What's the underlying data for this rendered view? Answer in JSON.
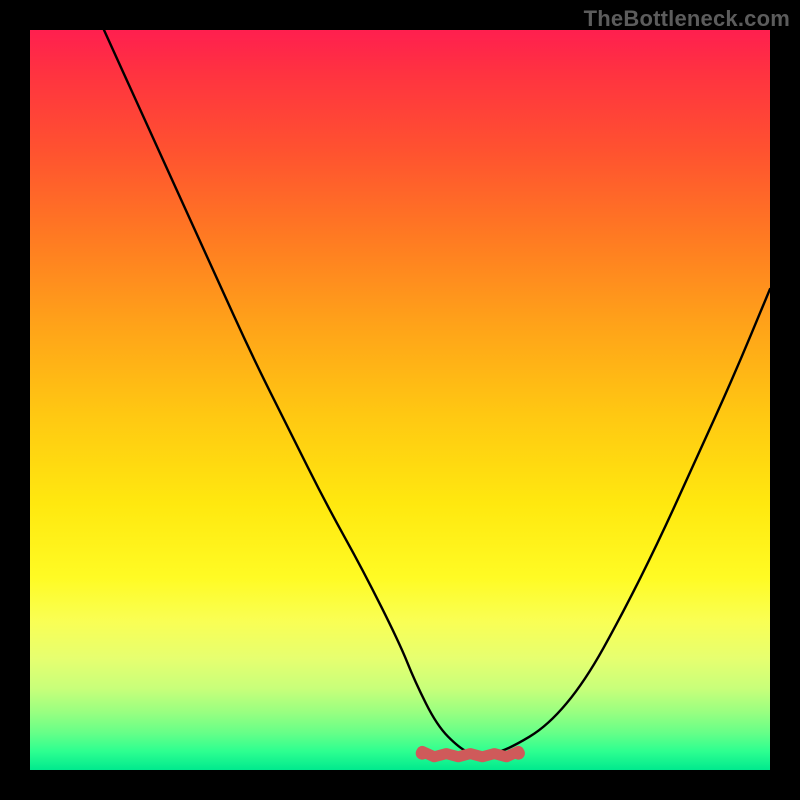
{
  "watermark": "TheBottleneck.com",
  "colors": {
    "frame_background": "#000000",
    "watermark_text": "#5c5c5c",
    "curve_stroke": "#000000",
    "marker_stroke": "#cf5a5a",
    "gradient_top": "#ff1f4f",
    "gradient_bottom": "#00e98e"
  },
  "chart_data": {
    "type": "line",
    "title": "",
    "xlabel": "",
    "ylabel": "",
    "xlim": [
      0,
      100
    ],
    "ylim": [
      0,
      100
    ],
    "grid": false,
    "legend": false,
    "series": [
      {
        "name": "bottleneck-curve",
        "x": [
          10,
          15,
          20,
          25,
          30,
          35,
          40,
          45,
          50,
          52,
          55,
          58,
          60,
          62,
          65,
          70,
          75,
          80,
          85,
          90,
          95,
          100
        ],
        "values": [
          100,
          89,
          78,
          67,
          56,
          46,
          36,
          27,
          17,
          12,
          6,
          3,
          2,
          2,
          3,
          6,
          12,
          21,
          31,
          42,
          53,
          65
        ]
      }
    ],
    "annotations": [
      {
        "name": "optimal-range",
        "x_start": 53,
        "x_end": 66,
        "y": 2
      }
    ],
    "background_gradient": {
      "direction": "vertical",
      "stops": [
        {
          "pos": 0.0,
          "color": "#ff1f4f"
        },
        {
          "pos": 0.16,
          "color": "#ff5130"
        },
        {
          "pos": 0.4,
          "color": "#ffa319"
        },
        {
          "pos": 0.64,
          "color": "#ffe80f"
        },
        {
          "pos": 0.85,
          "color": "#e6ff70"
        },
        {
          "pos": 1.0,
          "color": "#00e98e"
        }
      ]
    }
  }
}
